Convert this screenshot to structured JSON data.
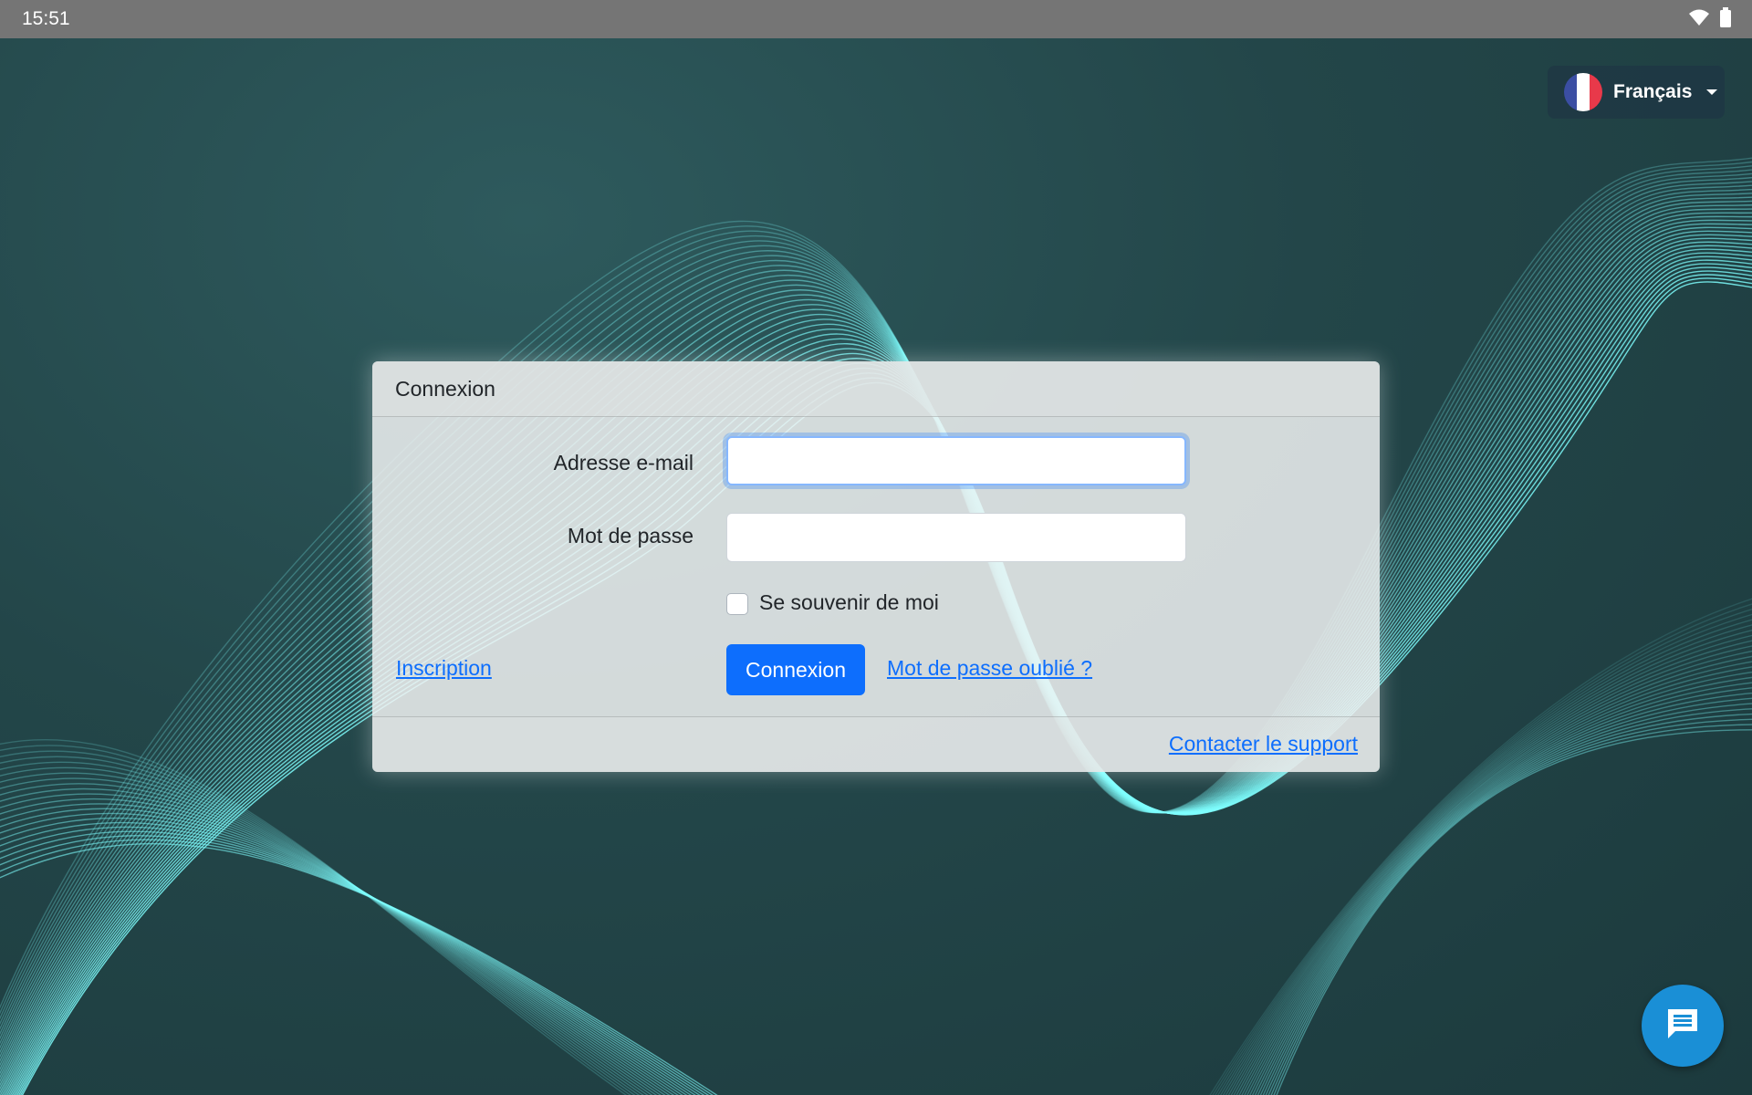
{
  "status_bar": {
    "time": "15:51",
    "icons": [
      "wifi-icon",
      "battery-icon"
    ]
  },
  "language": {
    "label": "Français",
    "flag_colors": [
      "#3b4ea3",
      "#ffffff",
      "#e8394a"
    ]
  },
  "login": {
    "title": "Connexion",
    "email_label": "Adresse e-mail",
    "email_value": "",
    "password_label": "Mot de passe",
    "password_value": "",
    "remember_label": "Se souvenir de moi",
    "remember_checked": false,
    "register_link": "Inscription",
    "submit_label": "Connexion",
    "forgot_link": "Mot de passe oublié ?",
    "support_link": "Contacter le support"
  },
  "chat": {
    "icon": "chat-icon"
  },
  "colors": {
    "primary": "#0d6efd",
    "chat": "#1a8fd6",
    "wave": "#7fffff"
  }
}
